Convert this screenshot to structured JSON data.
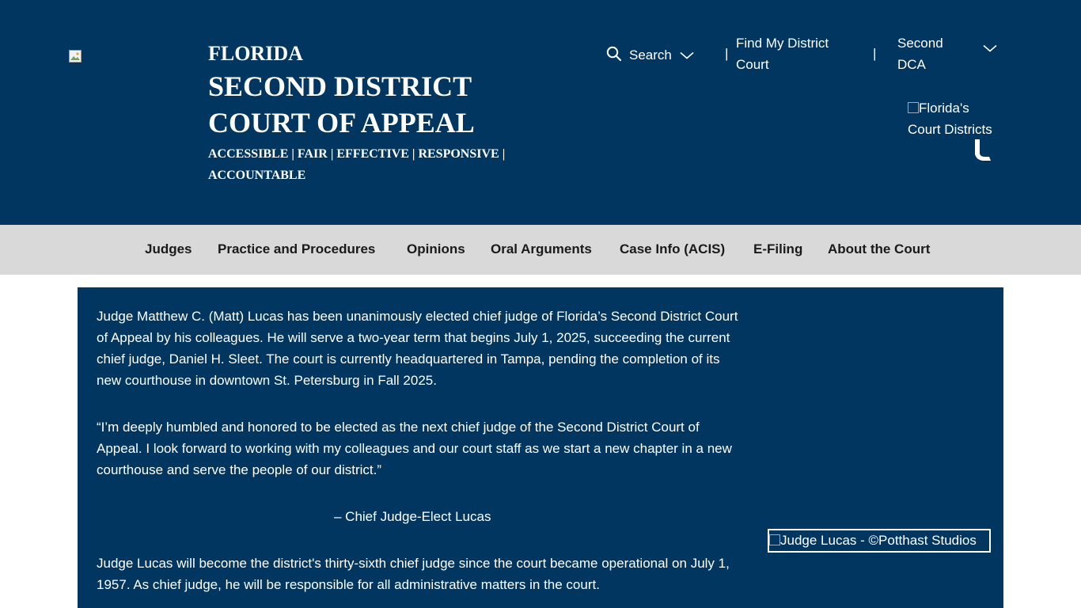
{
  "header": {
    "logo_icon": "broken-image-icon",
    "title_line1": "FLORIDA",
    "title_line2": "SECOND DISTRICT",
    "title_line3": "COURT OF APPEAL",
    "tagline": "ACCESSIBLE | FAIR | EFFECTIVE | RESPONSIVE | ACCOUNTABLE",
    "search_label": "Search",
    "separator": "|",
    "find_district_label": "Find My District Court",
    "district_select_value": "Second DCA",
    "districts_image_alt": "Florida's Court Districts",
    "colors": {
      "header_bg": "#00365f",
      "nav_bg": "#d9d9d9",
      "text_light": "#ffffff"
    }
  },
  "nav": {
    "items": [
      {
        "label": "Judges"
      },
      {
        "label": "Practice and Procedures"
      },
      {
        "label": "Opinions"
      },
      {
        "label": "Oral Arguments"
      },
      {
        "label": "Case Info (ACIS)"
      },
      {
        "label": "E-Filing"
      },
      {
        "label": "About the Court"
      }
    ]
  },
  "article": {
    "paragraph1": "Judge Matthew C. (Matt) Lucas has been unanimously elected chief judge of Florida’s Second District Court of Appeal by his colleagues. He will serve a two-year term that begins July 1, 2025, succeeding the current chief judge, Daniel H. Sleet. The court is currently headquartered in Tampa, pending the completion of its new courthouse in downtown St. Petersburg in Fall 2025.",
    "quote": "“I’m deeply humbled and honored to be elected as the next chief judge of the Second District Court of Appeal. I look forward to working with my colleagues and our court staff as we start a new chapter in a new courthouse and serve the people of our district.”",
    "attribution": "– Chief Judge-Elect Lucas",
    "paragraph3": "Judge Lucas will become the district's thirty-sixth chief judge since the court became operational on July 1, 1957. As chief judge, he will be responsible for all administrative matters in the court.",
    "photo_alt": "Judge Lucas - ©Potthast Studios"
  }
}
